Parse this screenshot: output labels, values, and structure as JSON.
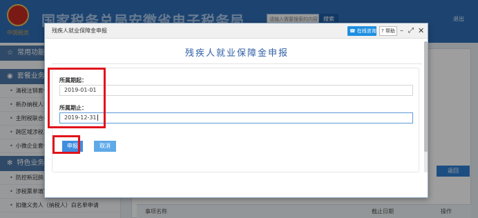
{
  "background": {
    "site_title": "国家税务总局安徽省电子税务局",
    "emblem_caption": "中国税务",
    "search_placeholder": "请输入需要搜索的内容",
    "search_button": "搜索",
    "exit_label": "退出",
    "sidebar": {
      "section1": "常用功能",
      "section2": "套餐业务",
      "section2_items": [
        "清税注销套餐",
        "新办纳税人套餐",
        "主附税联合申报",
        "跨区域涉税事项",
        "小微企业套餐"
      ],
      "section3": "特色业务",
      "section3_items": [
        "防控新冠肺炎",
        "涉税票单填写服务",
        "扣缴义务人（纳税人）白名单申请"
      ]
    },
    "return_button": "返回",
    "table_headers": [
      "事项名称",
      "截止日期",
      "操作"
    ]
  },
  "dialog": {
    "window_title": "残疾人就业保障金申报",
    "online_service": "在线咨询",
    "help": "帮助",
    "minimize_glyph": "–",
    "maximize_glyph": "⤢",
    "close_glyph": "✕",
    "heading": "残疾人就业保障金申报",
    "start_label": "所属期起：",
    "start_value": "2019-01-01",
    "end_label": "所属期止：",
    "end_value": "2019-12-31",
    "submit_button": "申报",
    "cancel_button": "取消"
  },
  "colors": {
    "header_blue": "#2f6fb7",
    "heading_blue": "#2f5fa6",
    "submit_blue": "#3f8ee0",
    "annotation_red": "#e0131a"
  }
}
